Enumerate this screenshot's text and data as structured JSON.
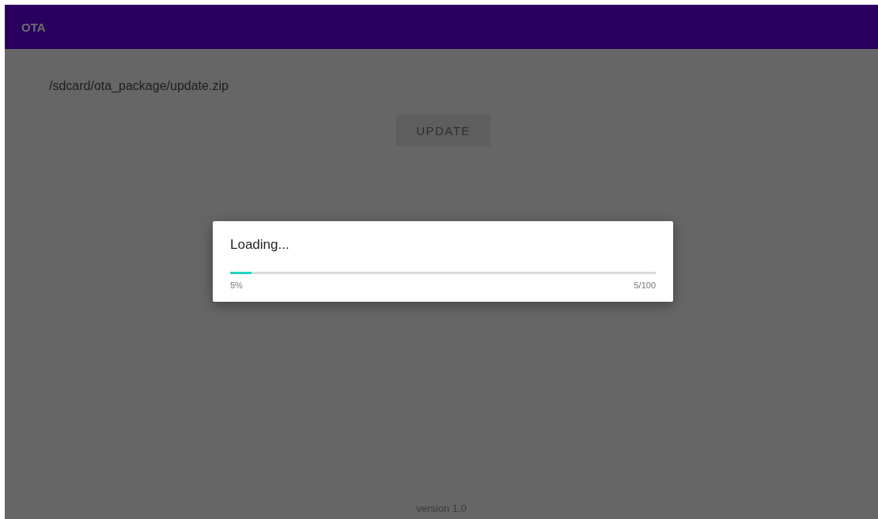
{
  "app_bar": {
    "title": "OTA"
  },
  "file_path": "/sdcard/ota_package/update.zip",
  "update_button": {
    "label": "UPDATE",
    "disabled": true
  },
  "dialog": {
    "title": "Loading...",
    "progress": {
      "level": 0.05,
      "percent": "5%",
      "count": "5/100"
    }
  },
  "footer": {
    "version": "version 1.0"
  }
}
